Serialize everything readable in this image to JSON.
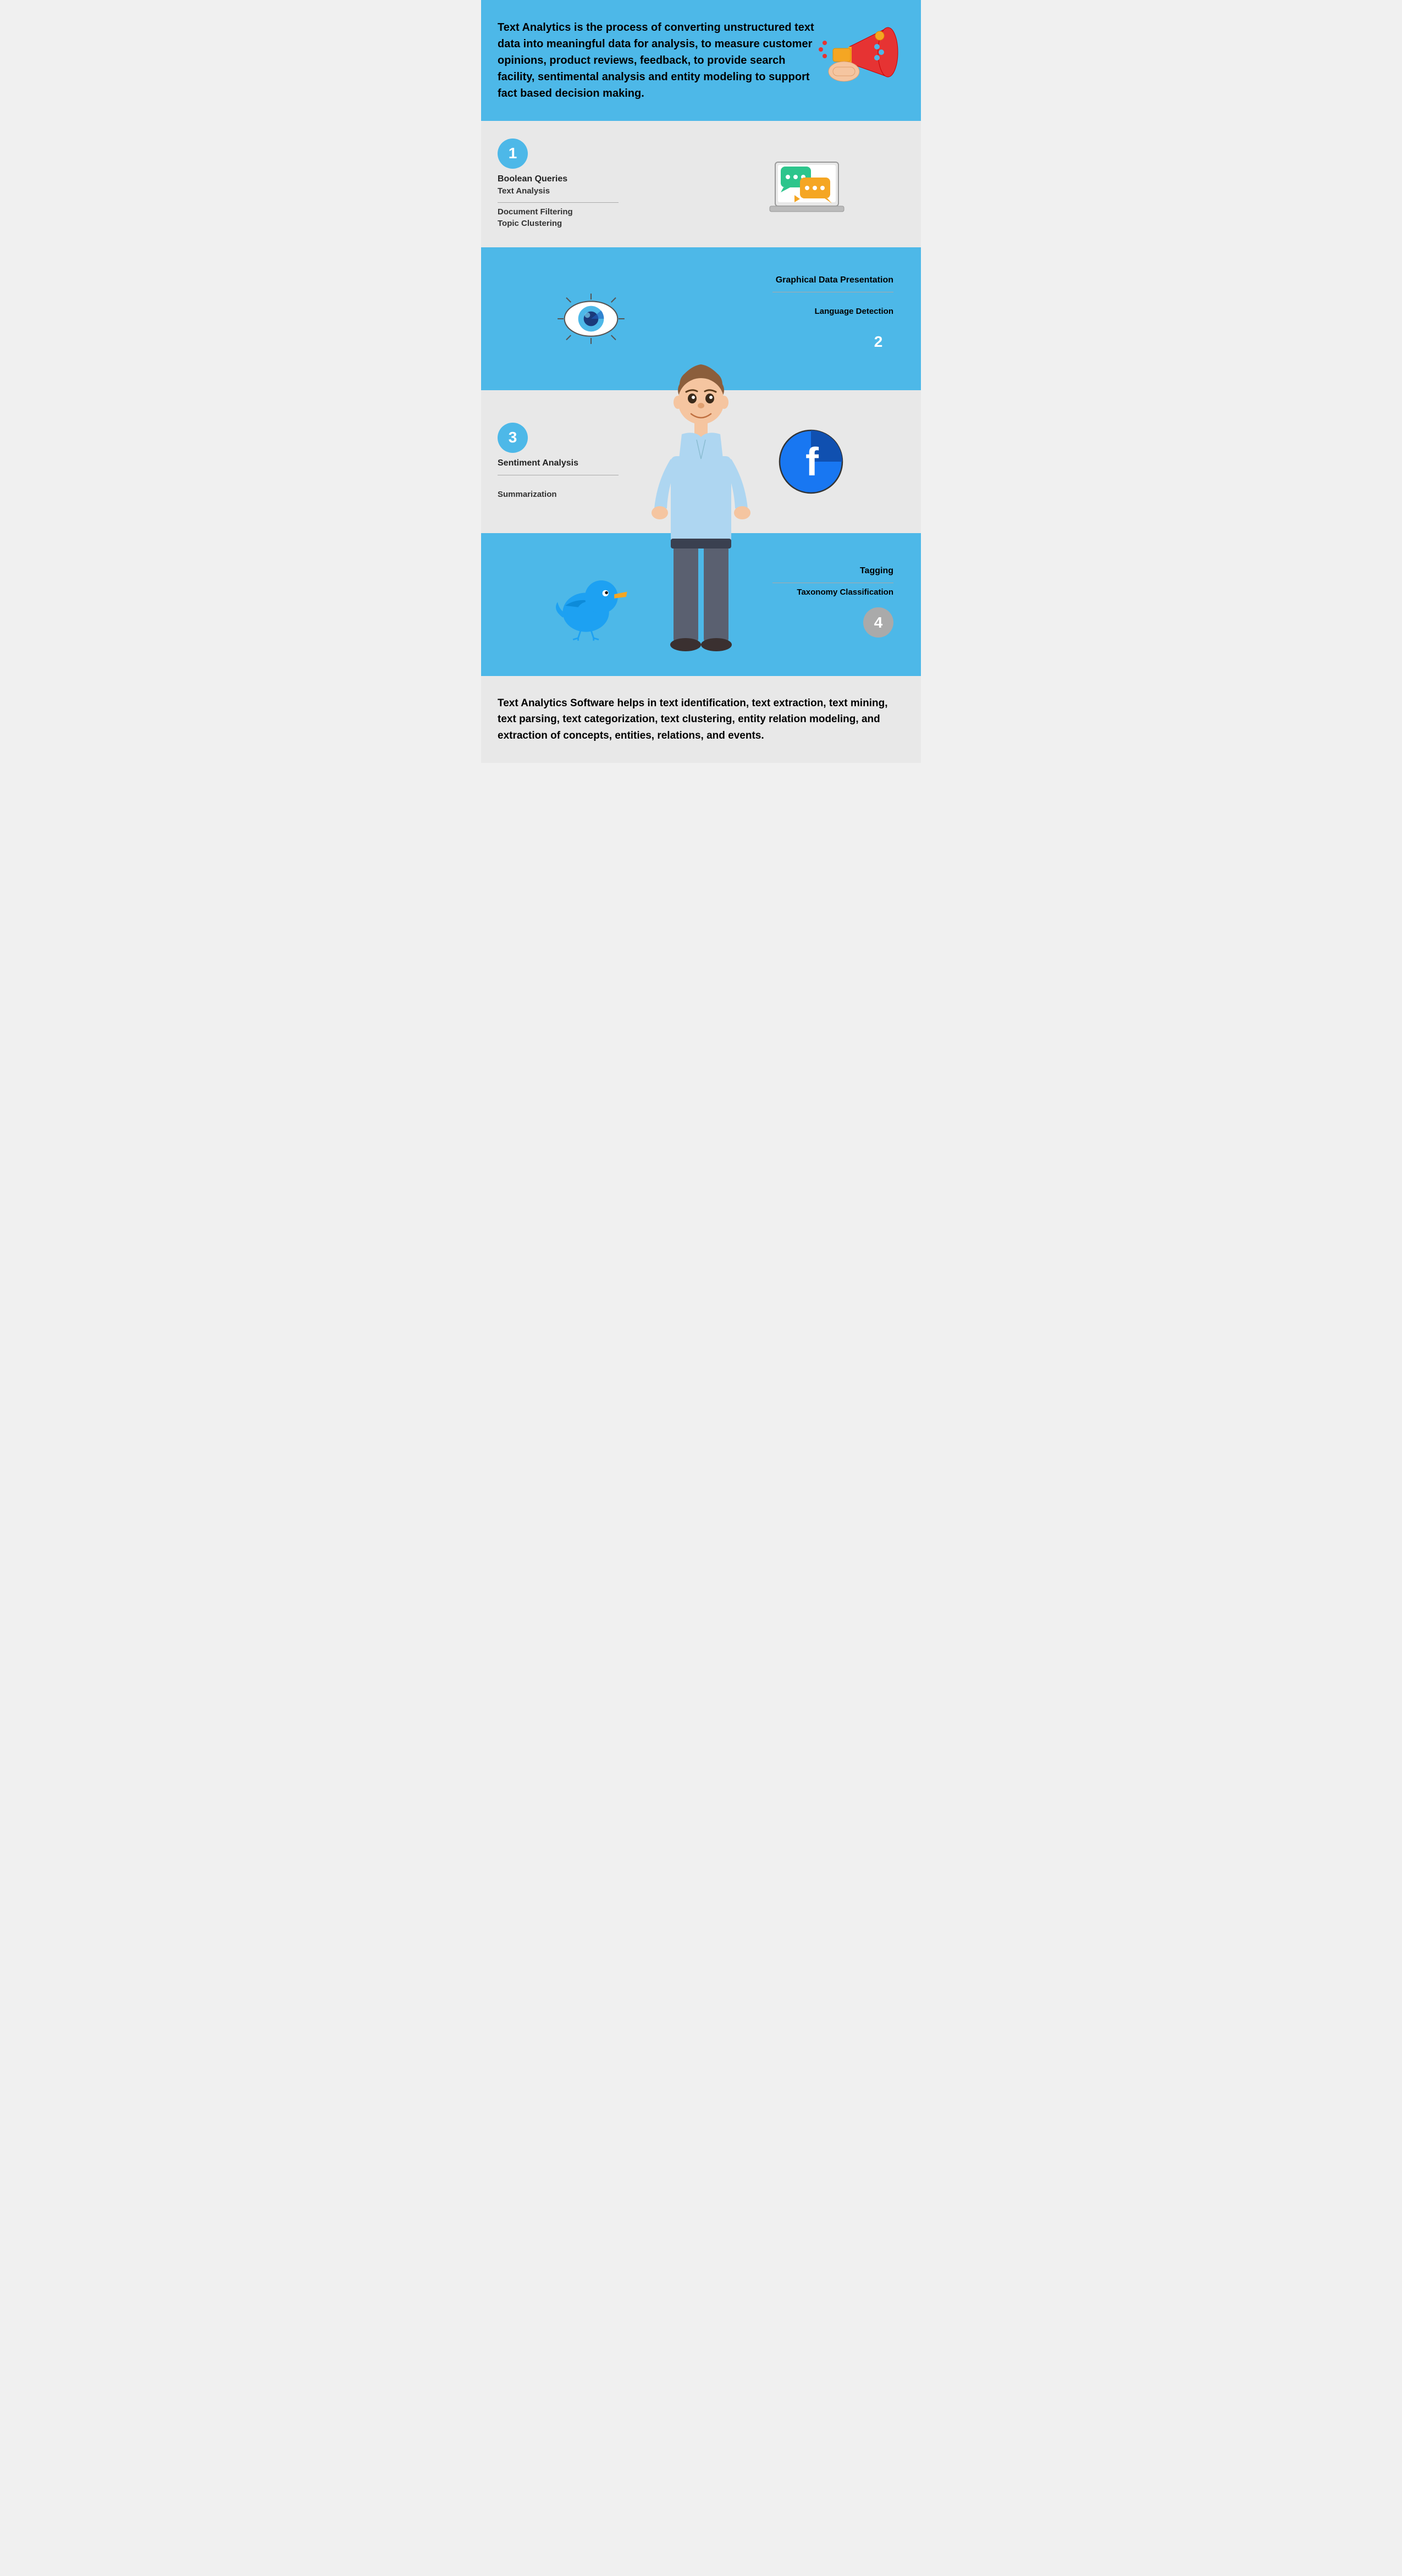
{
  "header": {
    "text": "Text Analytics  is the process of converting unstructured text data into meaningful  data for analysis, to measure customer opinions, product reviews,  feedback, to provide search facility, sentimental analysis and entity  modeling to support fact based decision making."
  },
  "row1": {
    "number": "1",
    "item1_title": "Boolean Queries",
    "item2": "Text Analysis",
    "item3": "Document Filtering",
    "item4": "Topic Clustering"
  },
  "row2": {
    "number": "2",
    "item1_title": "Graphical Data Presentation",
    "item2": "Language Detection"
  },
  "row3": {
    "number": "3",
    "item1_title": "Sentiment Analysis",
    "item2": "Summarization"
  },
  "row4": {
    "number": "4",
    "item1_title": "Tagging",
    "item2": "Taxonomy Classification"
  },
  "footer": {
    "text": "Text Analytics Software helps in text identification, text extraction,  text mining, text parsing, text categorization, text clustering, entity  relation modeling, and extraction of concepts, entities, relations, and  events."
  }
}
